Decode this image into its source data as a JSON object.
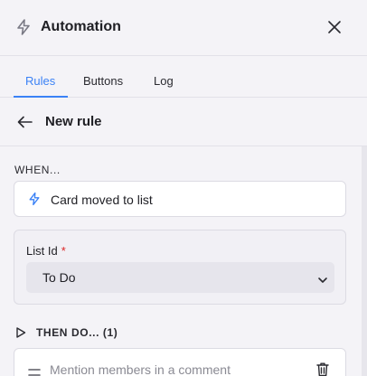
{
  "header": {
    "title": "Automation",
    "icon": "lightning-bolt-icon",
    "close_icon": "close-icon"
  },
  "tabs": [
    {
      "label": "Rules",
      "active": true
    },
    {
      "label": "Buttons",
      "active": false
    },
    {
      "label": "Log",
      "active": false
    }
  ],
  "subheader": {
    "title": "New rule",
    "back_icon": "arrow-left-icon"
  },
  "trigger_section": {
    "label": "WHEN...",
    "trigger": {
      "text": "Card moved to list",
      "icon": "lightning-bolt-icon"
    },
    "field": {
      "label": "List Id",
      "required_mark": "*",
      "value": "To Do"
    }
  },
  "actions_section": {
    "label": "THEN DO... (1)",
    "actions": [
      {
        "text": "Mention members in a comment",
        "icon": "drag-handle-icon",
        "delete_icon": "trash-icon"
      }
    ]
  },
  "colors": {
    "accent": "#3b82f6",
    "required": "#dc2626",
    "background": "#f4f3f7"
  }
}
